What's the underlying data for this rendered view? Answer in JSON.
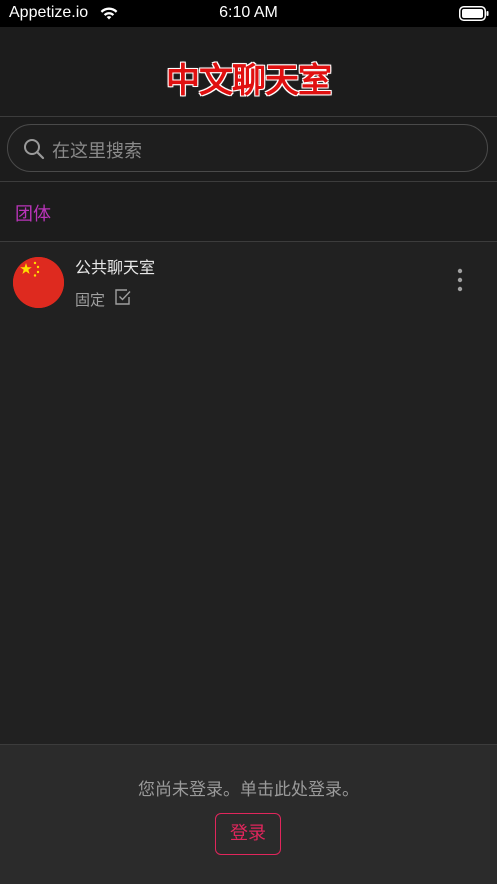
{
  "status_bar": {
    "carrier": "Appetize.io",
    "time": "6:10 AM"
  },
  "header": {
    "title": "中文聊天室",
    "title_color": "#e01010"
  },
  "search": {
    "placeholder": "在这里搜索"
  },
  "section": {
    "title": "团体",
    "color": "#b834b8"
  },
  "chats": [
    {
      "name": "公共聊天室",
      "pinned_label": "固定",
      "pinned": true,
      "avatar": "china-flag-icon"
    }
  ],
  "footer": {
    "prompt": "您尚未登录。单击此处登录。",
    "login_label": "登录",
    "accent": "#e0265c"
  }
}
